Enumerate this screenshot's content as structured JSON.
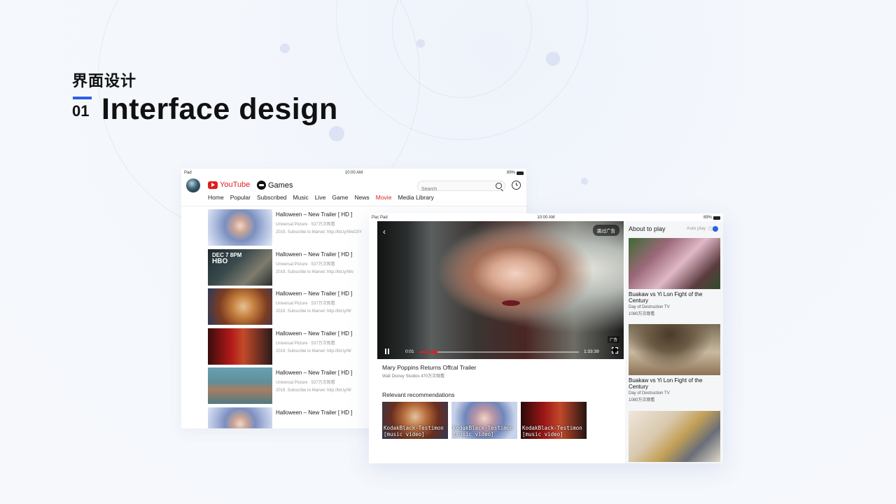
{
  "page": {
    "heading_cn": "界面设计",
    "heading_num": "01",
    "heading_en": "Interface design",
    "accent_color": "#2e5ee8"
  },
  "tablet1": {
    "status": {
      "device": "Pad",
      "time": "10:00 AM",
      "battery": "89%"
    },
    "brand": {
      "youtube": "YouTube",
      "games": "Games"
    },
    "search_placeholder": "Search",
    "nav": [
      "Home",
      "Popular",
      "Subscribed",
      "Music",
      "Live",
      "Game",
      "News",
      "Movie",
      "Media Library"
    ],
    "active_nav": "Movie",
    "videos": [
      {
        "title": "Halloween – New Trailer [ HD ]",
        "meta": "Universal Picture · 537万次观看",
        "desc": "2019.  Subscribe to Marvel: http://bit.ly/WeO3Y"
      },
      {
        "title": "Halloween – New Trailer [ HD ]",
        "meta": "Universal Picture · 537万次观看",
        "desc": "2019.  Subscribe to Marvel: http://bit.ly/Wo",
        "overlay_date": "DEC 7 8PM",
        "overlay_brand": "HBO"
      },
      {
        "title": "Halloween – New Trailer [ HD ]",
        "meta": "Universal Picture · 537万次观看",
        "desc": "2019.  Subscribe to Marvel: http://bit.ly/W"
      },
      {
        "title": "Halloween – New Trailer [ HD ]",
        "meta": "Universal Picture · 537万次观看",
        "desc": "2019.  Subscribe to Marvel: http://bit.ly/W"
      },
      {
        "title": "Halloween – New Trailer [ HD ]",
        "meta": "Universal Picture · 537万次观看",
        "desc": "2019.  Subscribe to Marvel: http://bit.ly/W"
      },
      {
        "title": "Halloween – New Trailer [ HD ]"
      }
    ]
  },
  "tablet2": {
    "status": {
      "device": "Pac Pad",
      "time": "10:00 AM",
      "battery": "89%"
    },
    "player": {
      "skip_ad": "跳过广告",
      "ad_label": "广告",
      "current_time": "0:01",
      "total_time": "1:33:39",
      "progress": 0.1
    },
    "movie_title": "Mary Poppins Returns  Offcal Trailer",
    "movie_meta": "Walt Disney Studios   470万次观看",
    "relevant_title": "Relevant recommendations",
    "relevant": [
      {
        "line1": "KodakBlack-Testimon",
        "line2": "[music video]"
      },
      {
        "line1": "KodakBlack-Testimon",
        "line2": "[music video]"
      },
      {
        "line1": "KodakBlack-Testimon",
        "line2": "[music video]"
      }
    ],
    "side": {
      "about_title": "About to play",
      "autoplay_label": "Auto play",
      "autoplay_on": true,
      "cards": [
        {
          "title": "Buakaw vs Yi Lon Fight of the Century",
          "channel": "Day of Destruction TV",
          "views": "1080万次观看"
        },
        {
          "title": "Buakaw vs Yi Lon Fight of the Century",
          "channel": "Day of Destruction TV",
          "views": "1080万次观看"
        },
        {
          "title": ""
        }
      ]
    }
  }
}
